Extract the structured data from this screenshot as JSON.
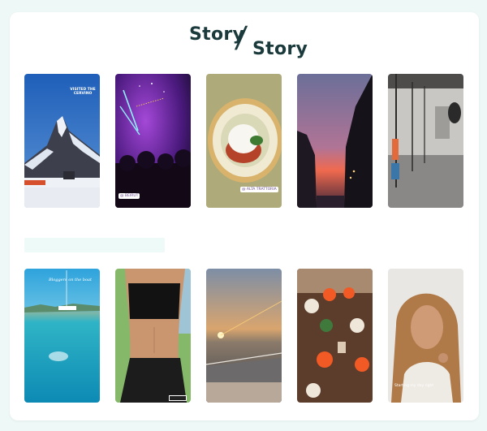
{
  "title": {
    "part1": "Story",
    "separator": "/",
    "part2": "Story"
  },
  "row1": [
    {
      "name": "matterhorn",
      "caption_top": "VISITED THE CERVINO",
      "tag": ""
    },
    {
      "name": "concert",
      "caption_top": "",
      "tag": "@ BEIRUT"
    },
    {
      "name": "burrata-dish",
      "caption_top": "",
      "tag": "@ ALTA TRATTORIA"
    },
    {
      "name": "paris-sunset-street",
      "caption_top": "",
      "tag": ""
    },
    {
      "name": "industrial-market",
      "caption_top": "",
      "tag": ""
    }
  ],
  "row2": [
    {
      "name": "sea-bay",
      "caption_top": "Bloggers on the boat",
      "tag": ""
    },
    {
      "name": "fitness-body",
      "caption_top": "",
      "tag": ""
    },
    {
      "name": "sunset-boat",
      "caption_top": "",
      "tag": ""
    },
    {
      "name": "aperol-table",
      "caption_top": "",
      "tag": ""
    },
    {
      "name": "portrait-woman",
      "caption_top": "",
      "tag": "Starting my day right"
    }
  ]
}
